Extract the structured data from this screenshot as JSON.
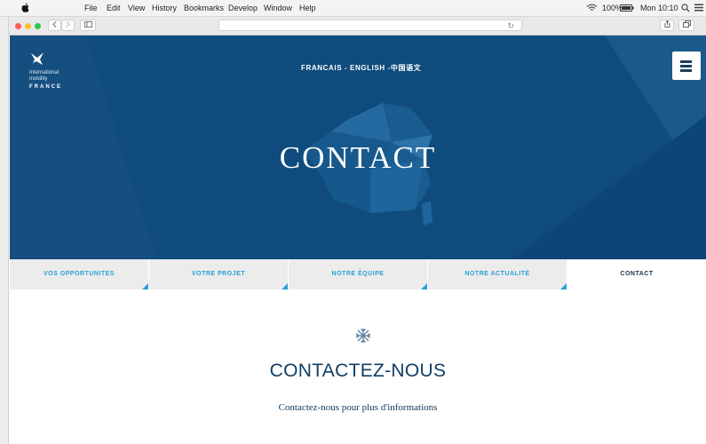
{
  "menubar": {
    "items": [
      "File",
      "Edit",
      "View",
      "History",
      "Bookmarks",
      "Develop",
      "Window",
      "Help"
    ],
    "battery": "100%",
    "clock": "Mon 10:10"
  },
  "hero": {
    "logo": {
      "line1": "International",
      "line2": "mobility",
      "line3": "FRANCE"
    },
    "languages": "FRANCAIS - ENGLISH -中国语文",
    "title": "CONTACT"
  },
  "tabs": [
    {
      "label": "VOS OPPORTUNITES"
    },
    {
      "label": "VOTRE PROJET"
    },
    {
      "label": "NOTRE ÉQUIPE"
    },
    {
      "label": "NOTRE ACTUALITÉ"
    },
    {
      "label": "CONTACT"
    }
  ],
  "content": {
    "heading": "CONTACTEZ-NOUS",
    "subheading": "Contactez-nous pour plus d'informations"
  },
  "colors": {
    "hero_bg": "#0f4c7d",
    "accent": "#2a9fd6",
    "heading": "#123e64"
  }
}
